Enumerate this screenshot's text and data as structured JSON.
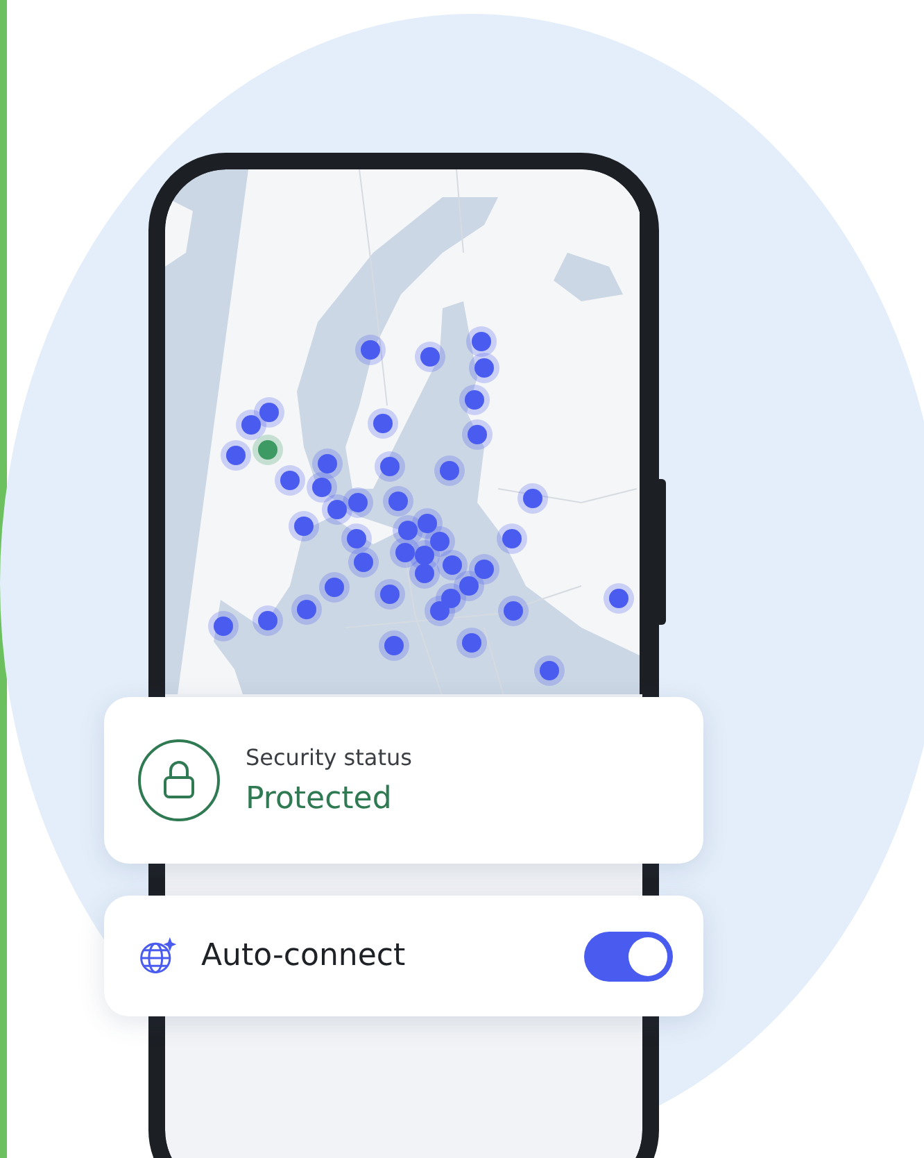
{
  "map": {
    "pins": [
      {
        "color": "#4a5cf0"
      },
      {
        "color": "#4a5cf0"
      },
      {
        "color": "#4a5cf0"
      },
      {
        "color": "#4a5cf0"
      },
      {
        "color": "#4a5cf0"
      },
      {
        "color": "#4a5cf0"
      },
      {
        "color": "#4a5cf0"
      },
      {
        "color": "#4a5cf0"
      },
      {
        "color": "#4a5cf0"
      },
      {
        "color": "#4a5cf0"
      },
      {
        "color": "#3d9a62"
      },
      {
        "color": "#4a5cf0"
      },
      {
        "color": "#4a5cf0"
      },
      {
        "color": "#4a5cf0"
      },
      {
        "color": "#4a5cf0"
      },
      {
        "color": "#4a5cf0"
      },
      {
        "color": "#4a5cf0"
      },
      {
        "color": "#4a5cf0"
      },
      {
        "color": "#4a5cf0"
      },
      {
        "color": "#4a5cf0"
      },
      {
        "color": "#4a5cf0"
      },
      {
        "color": "#4a5cf0"
      },
      {
        "color": "#4a5cf0"
      },
      {
        "color": "#4a5cf0"
      },
      {
        "color": "#4a5cf0"
      },
      {
        "color": "#4a5cf0"
      },
      {
        "color": "#4a5cf0"
      },
      {
        "color": "#4a5cf0"
      },
      {
        "color": "#4a5cf0"
      },
      {
        "color": "#4a5cf0"
      },
      {
        "color": "#4a5cf0"
      },
      {
        "color": "#4a5cf0"
      },
      {
        "color": "#4a5cf0"
      },
      {
        "color": "#4a5cf0"
      },
      {
        "color": "#4a5cf0"
      },
      {
        "color": "#4a5cf0"
      },
      {
        "color": "#4a5cf0"
      },
      {
        "color": "#4a5cf0"
      },
      {
        "color": "#4a5cf0"
      },
      {
        "color": "#4a5cf0"
      },
      {
        "color": "#4a5cf0"
      },
      {
        "color": "#4a5cf0"
      },
      {
        "color": "#4a5cf0"
      },
      {
        "color": "#4a5cf0"
      },
      {
        "color": "#4a5cf0"
      }
    ]
  },
  "security": {
    "label": "Security status",
    "value": "Protected"
  },
  "auto_connect": {
    "label": "Auto-connect",
    "on": true
  }
}
